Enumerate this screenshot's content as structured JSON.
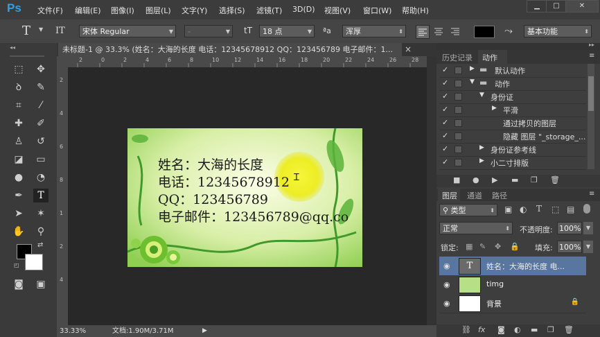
{
  "menubar": {
    "logo": "Ps",
    "items": [
      "文件(F)",
      "编辑(E)",
      "图像(I)",
      "图层(L)",
      "文字(Y)",
      "选择(S)",
      "滤镜(T)",
      "3D(D)",
      "视图(V)",
      "窗口(W)",
      "帮助(H)"
    ],
    "minimize": "▁",
    "maximize": "□",
    "close": "✕"
  },
  "options": {
    "tool_glyph": "T",
    "orient_glyph": "IT",
    "font_family": "宋体 Regular",
    "font_style": "-",
    "size_glyph": "tT",
    "font_size": "18 点",
    "aa_glyph": "ªa",
    "anti_alias": "浑厚",
    "workspace": "基本功能"
  },
  "document": {
    "tab_title": "未标题-1 @ 33.3% (姓名：大海的长度 电话：12345678912 QQ：123456789 电子邮件：1...",
    "tab_close": "×",
    "zoom": "33.33%",
    "doc_size": "文档:1.90M/3.71M",
    "ruler_h": [
      "2",
      "0",
      "2",
      "4",
      "6",
      "8",
      "10",
      "12",
      "14",
      "16",
      "18",
      "20",
      "22",
      "24",
      "26",
      "28"
    ],
    "ruler_v": [
      "2",
      "4",
      "6",
      "8",
      "1",
      "2",
      "4"
    ],
    "card_lines": [
      "姓名：大海的长度",
      "电话：12345678912",
      "QQ：123456789",
      "电子邮件：123456789@qq.co"
    ]
  },
  "actions_panel": {
    "tabs": [
      "历史记录",
      "动作"
    ],
    "rows": [
      {
        "label": "默认动作",
        "level": 0,
        "arrow": "▶",
        "kind": "folder",
        "check": "✓"
      },
      {
        "label": "动作",
        "level": 0,
        "arrow": "▼",
        "kind": "folder",
        "check": "✓"
      },
      {
        "label": "身份证",
        "level": 1,
        "arrow": "▼",
        "kind": "item",
        "check": "✓"
      },
      {
        "label": "平滑",
        "level": 2,
        "arrow": "▶",
        "kind": "item",
        "check": "✓"
      },
      {
        "label": "通过拷贝的图层",
        "level": 3,
        "arrow": "",
        "kind": "item",
        "check": "✓"
      },
      {
        "label": "隐藏 图层 \"_storage_...",
        "level": 3,
        "arrow": "",
        "kind": "item",
        "check": "✓"
      },
      {
        "label": "身份证参考线",
        "level": 1,
        "arrow": "▶",
        "kind": "item",
        "check": "✓"
      },
      {
        "label": "小二寸排版",
        "level": 1,
        "arrow": "▶",
        "kind": "item",
        "check": "✓"
      }
    ]
  },
  "layers_panel": {
    "tabs": [
      "图层",
      "通道",
      "路径"
    ],
    "filter": "类型",
    "blend": "正常",
    "opacity_label": "不透明度:",
    "opacity": "100%",
    "lock_label": "锁定:",
    "fill_label": "填充:",
    "fill": "100%",
    "layers": [
      {
        "name": "姓名：大海的长度 电...",
        "thumb": "T",
        "selected": true
      },
      {
        "name": "timg",
        "thumb": "",
        "selected": false
      },
      {
        "name": "背景",
        "thumb": "",
        "selected": false
      }
    ]
  },
  "colors": {
    "ps_blue": "#2fa0e6",
    "card_green": "#b9e07a",
    "sun": "#f0f02a"
  }
}
